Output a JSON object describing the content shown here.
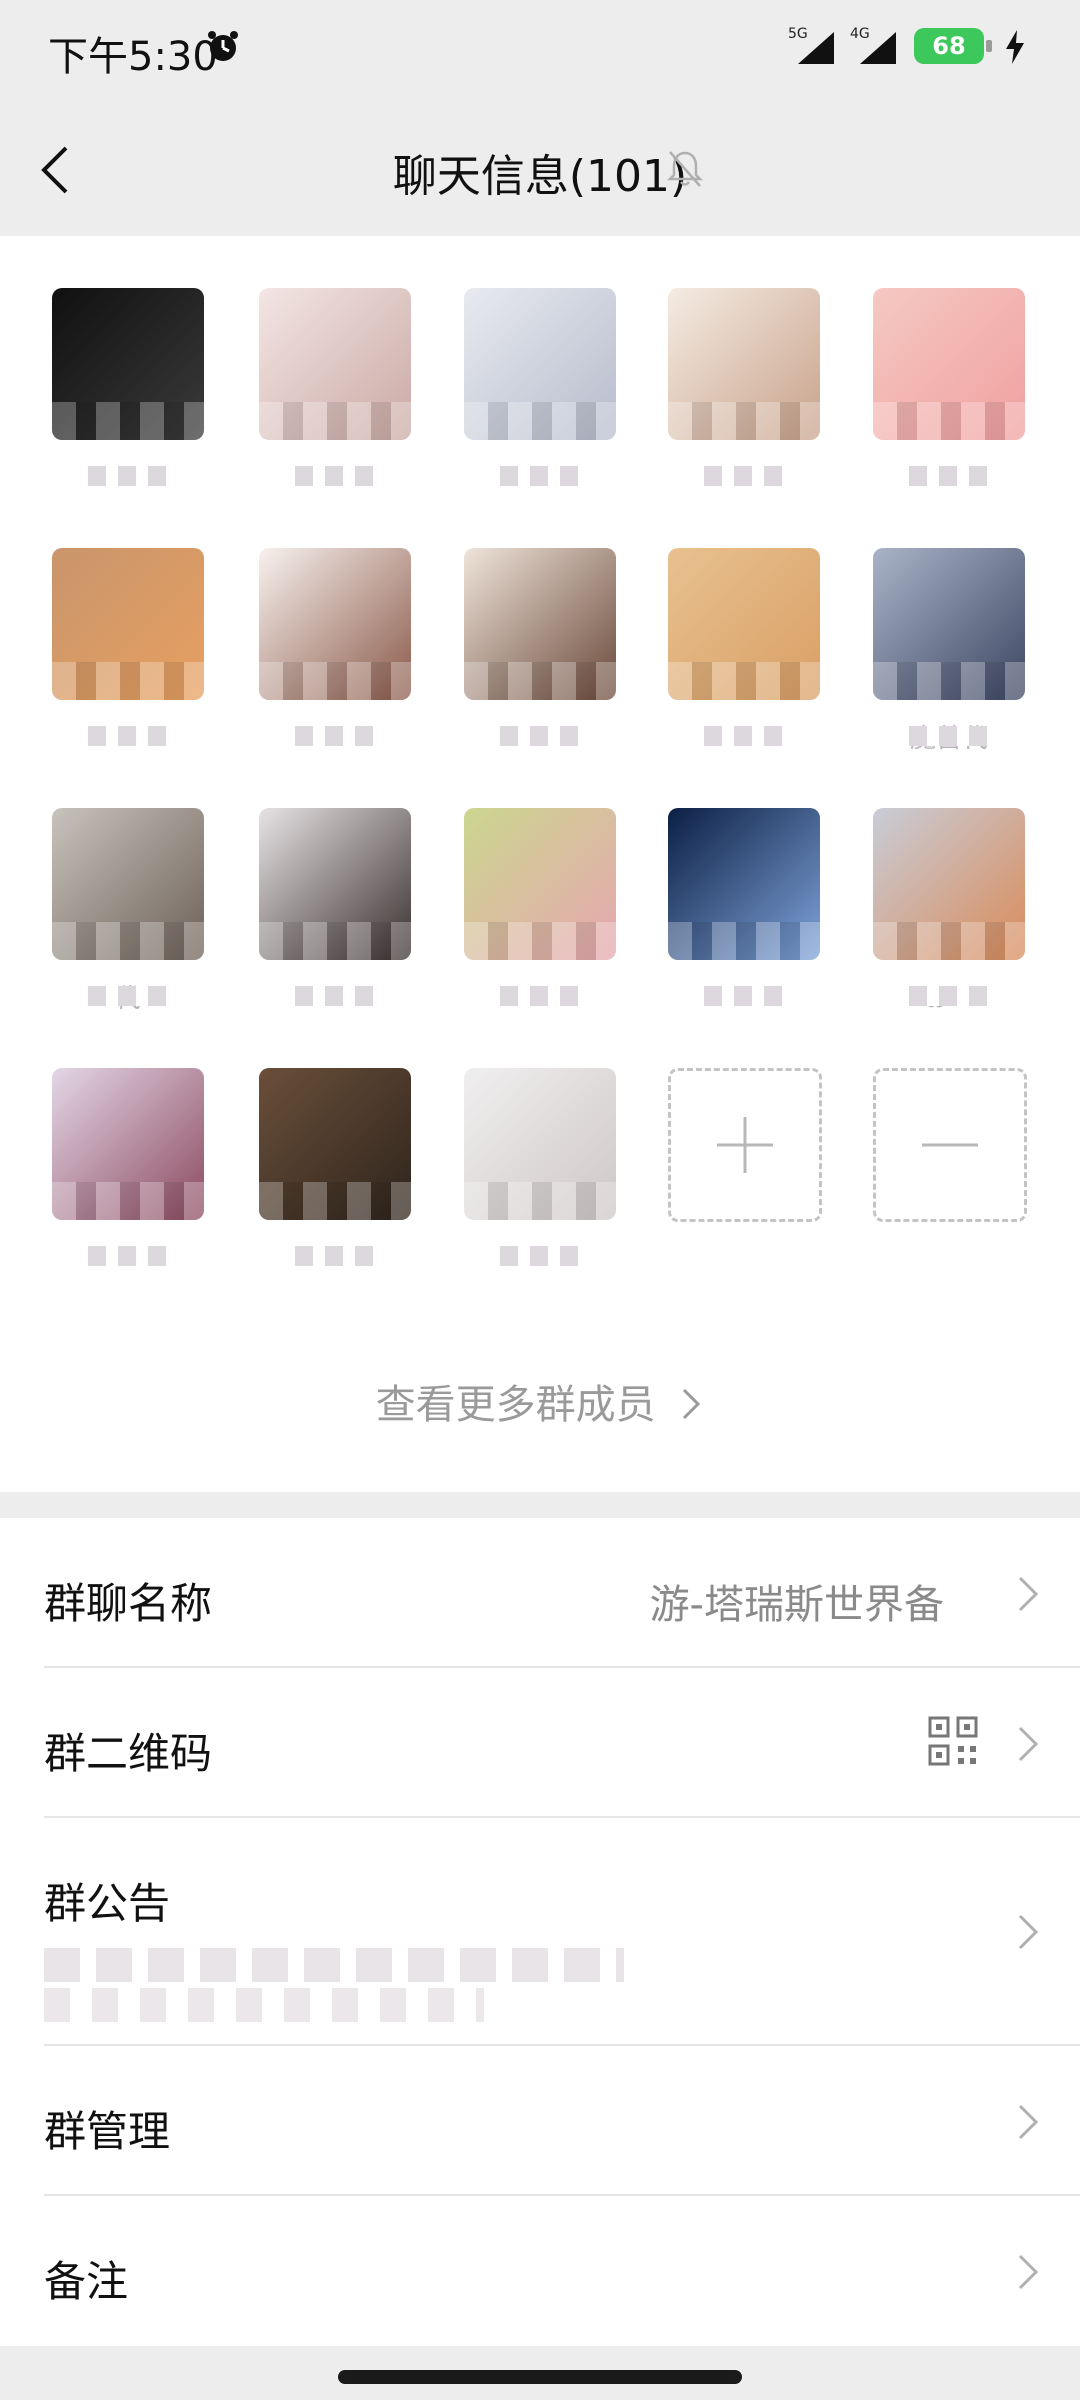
{
  "status_bar": {
    "time": "下午5:30",
    "network_1": "5G",
    "network_2": "4G",
    "battery": "68"
  },
  "nav": {
    "title": "聊天信息(101)"
  },
  "members": [
    {
      "name": "",
      "colors": [
        "#101010",
        "#3a3a3a"
      ]
    },
    {
      "name": "",
      "colors": [
        "#f3e6e4",
        "#caa9a4"
      ]
    },
    {
      "name": "",
      "colors": [
        "#e8eaf0",
        "#b7bccc"
      ]
    },
    {
      "name": "",
      "colors": [
        "#f5ece4",
        "#c8a28a"
      ]
    },
    {
      "name": "",
      "colors": [
        "#f5c9c2",
        "#f0a0a0"
      ]
    },
    {
      "name": "",
      "colors": [
        "#c9956c",
        "#e7a060"
      ]
    },
    {
      "name": "",
      "colors": [
        "#f7f1ee",
        "#8b5a4a"
      ]
    },
    {
      "name": "",
      "colors": [
        "#efe4da",
        "#6b4a3b"
      ]
    },
    {
      "name": "",
      "colors": [
        "#e8c18f",
        "#d99f66"
      ]
    },
    {
      "name": "魔兽代",
      "colors": [
        "#aab4c8",
        "#3c4662"
      ]
    },
    {
      "name": "代",
      "colors": [
        "#c8c3bd",
        "#6d6157"
      ]
    },
    {
      "name": "",
      "colors": [
        "#e7e3e4",
        "#3a3030"
      ]
    },
    {
      "name": "",
      "colors": [
        "#cbd68f",
        "#e6a7b0"
      ]
    },
    {
      "name": "",
      "colors": [
        "#0b1f44",
        "#7fa3d9"
      ]
    },
    {
      "name": "ఎ〰",
      "colors": [
        "#c9cdd8",
        "#d98b5a"
      ]
    },
    {
      "name": "",
      "colors": [
        "#e3d7e6",
        "#8c4a60"
      ]
    },
    {
      "name": "",
      "colors": [
        "#6a4f3a",
        "#2e241c"
      ]
    },
    {
      "name": "",
      "colors": [
        "#f0efef",
        "#cfc7c7"
      ]
    }
  ],
  "more_members": "查看更多群成员",
  "settings": {
    "group_name_label": "群聊名称",
    "group_name_value": "游-塔瑞斯世界备",
    "qr_label": "群二维码",
    "notice_label": "群公告",
    "manage_label": "群管理",
    "remark_label": "备注"
  }
}
